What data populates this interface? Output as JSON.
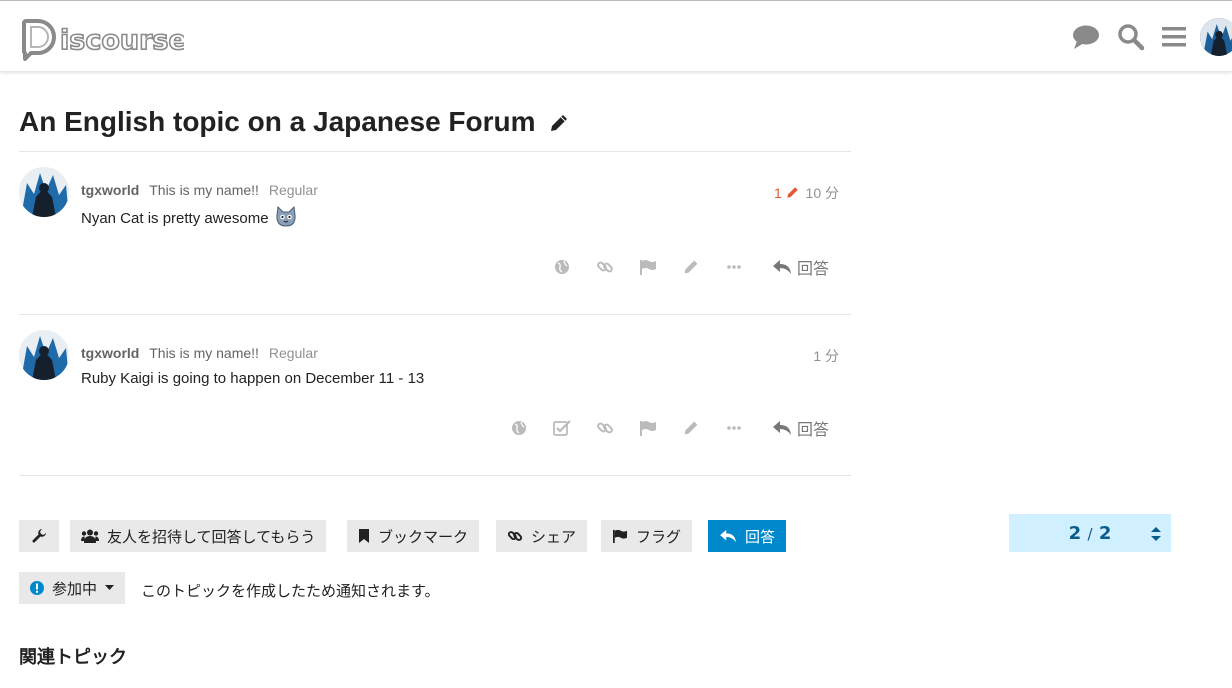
{
  "header": {
    "logo_text": "Discourse",
    "icons": [
      "chat-icon",
      "search-icon",
      "hamburger-menu-icon",
      "user-avatar"
    ]
  },
  "topic": {
    "title": "An English topic on a Japanese Forum"
  },
  "posts": [
    {
      "username": "tgxworld",
      "user_title": "This is my name!!",
      "user_group": "Regular",
      "edit_count": "1",
      "date": "10 分",
      "content": "Nyan Cat is pretty awesome",
      "reply_label": "回答"
    },
    {
      "username": "tgxworld",
      "user_title": "This is my name!!",
      "user_group": "Regular",
      "date": "1 分",
      "content": "Ruby Kaigi is going to happen on December 11 - 13",
      "reply_label": "回答"
    }
  ],
  "footer_buttons": {
    "invite": "友人を招待して回答してもらう",
    "bookmark": "ブックマーク",
    "share": "シェア",
    "flag": "フラグ",
    "reply": "回答"
  },
  "progress": {
    "current": "2",
    "separator": "/",
    "total": "2"
  },
  "notifications": {
    "level": "参加中",
    "reason": "このトピックを作成したため通知されます。"
  },
  "related": {
    "heading": "関連トピック"
  },
  "colors": {
    "primary": "#0088cc",
    "progress_bg": "#d1f0ff",
    "edit_accent": "#e45735",
    "button_bg": "#e9e9e9"
  }
}
